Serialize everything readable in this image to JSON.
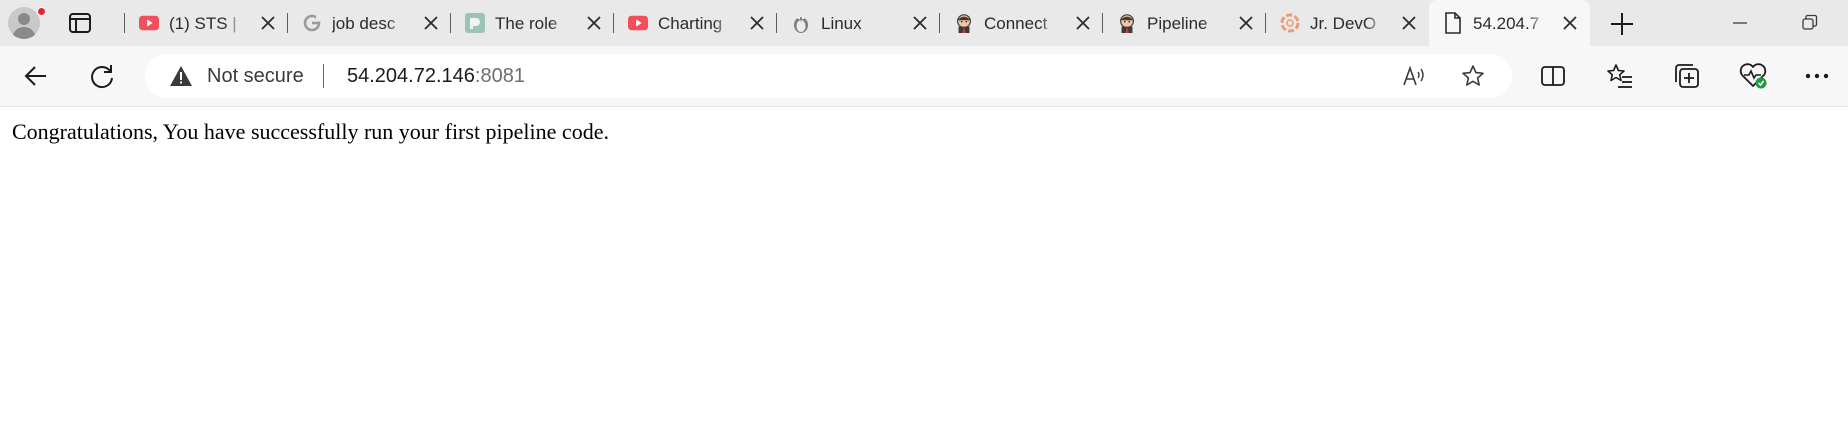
{
  "browser": {
    "tabs": [
      {
        "title": "(1) STS |",
        "icon": "youtube-icon",
        "active": false
      },
      {
        "title": "job desc",
        "icon": "google-icon",
        "active": false
      },
      {
        "title": "The role",
        "icon": "site-logo-icon",
        "active": false
      },
      {
        "title": "Charting",
        "icon": "youtube-icon",
        "active": false
      },
      {
        "title": "Linux",
        "icon": "linux-tux-icon",
        "active": false
      },
      {
        "title": "Connect",
        "icon": "jenkins-icon",
        "active": false
      },
      {
        "title": "Pipeline",
        "icon": "jenkins-icon",
        "active": false
      },
      {
        "title": "Jr. DevO",
        "icon": "lifebuoy-icon",
        "active": false
      },
      {
        "title": "54.204.7",
        "icon": "page-icon",
        "active": true
      }
    ],
    "address_bar": {
      "security_label": "Not secure",
      "host": "54.204.72.146",
      "port": ":8081"
    },
    "colors": {
      "youtube_red": "#f24f5a",
      "accent_green": "#1a9c3e",
      "tab_strip": "#e9e9e9",
      "toolbar": "#f7f7f7"
    }
  },
  "page": {
    "message": "Congratulations, You have successfully run your first pipeline code."
  }
}
